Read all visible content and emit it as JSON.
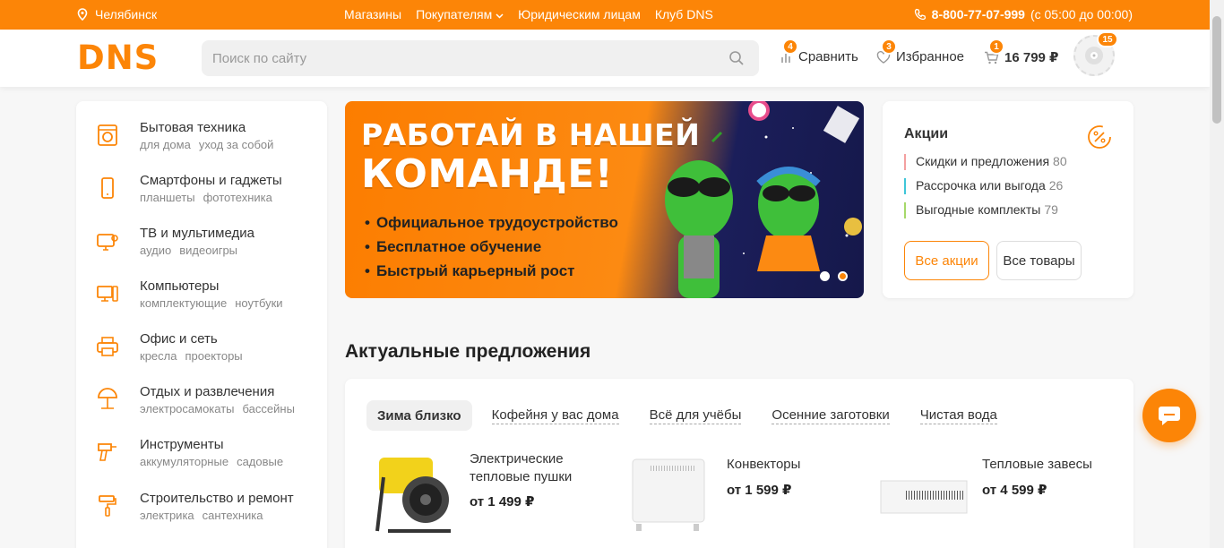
{
  "topbar": {
    "city": "Челябинск",
    "nav": [
      "Магазины",
      "Покупателям",
      "Юридическим лицам",
      "Клуб DNS"
    ],
    "phone": "8-800-77-07-999",
    "hours": "(с 05:00 до 00:00)"
  },
  "header": {
    "logo": "DNS",
    "search_placeholder": "Поиск по сайту",
    "compare_label": "Сравнить",
    "compare_count": "4",
    "favorites_label": "Избранное",
    "favorites_count": "3",
    "cart_count": "1",
    "cart_total": "16 799 ₽",
    "profile_count": "15"
  },
  "sidebar": {
    "items": [
      {
        "title": "Бытовая техника",
        "sub1": "для дома",
        "sub2": "уход за собой"
      },
      {
        "title": "Смартфоны и гаджеты",
        "sub1": "планшеты",
        "sub2": "фототехника"
      },
      {
        "title": "ТВ и мультимедиа",
        "sub1": "аудио",
        "sub2": "видеоигры"
      },
      {
        "title": "Компьютеры",
        "sub1": "комплектующие",
        "sub2": "ноутбуки"
      },
      {
        "title": "Офис и сеть",
        "sub1": "кресла",
        "sub2": "проекторы"
      },
      {
        "title": "Отдых и развлечения",
        "sub1": "электросамокаты",
        "sub2": "бассейны"
      },
      {
        "title": "Инструменты",
        "sub1": "аккумуляторные",
        "sub2": "садовые"
      },
      {
        "title": "Строительство и ремонт",
        "sub1": "электрика",
        "sub2": "сантехника"
      }
    ]
  },
  "banner": {
    "line1": "РАБОТАЙ В НАШЕЙ",
    "line2": "КОМАНДЕ!",
    "bullets": [
      "Официальное трудоустройство",
      "Бесплатное обучение",
      "Быстрый карьерный рост"
    ]
  },
  "promo": {
    "title": "Акции",
    "items": [
      {
        "label": "Скидки и предложения",
        "count": "80",
        "color": "#f4a0a0"
      },
      {
        "label": "Рассрочка или выгода",
        "count": "26",
        "color": "#3fc6d9"
      },
      {
        "label": "Выгодные комплекты",
        "count": "79",
        "color": "#a6d96a"
      }
    ],
    "all_promos": "Все акции",
    "all_goods": "Все товары"
  },
  "offers": {
    "title": "Актуальные предложения",
    "tabs": [
      "Зима близко",
      "Кофейня у вас дома",
      "Всё для учёбы",
      "Осенние заготовки",
      "Чистая вода"
    ],
    "products": [
      {
        "name1": "Электрические",
        "name2": "тепловые пушки",
        "price": "от 1 499 ₽"
      },
      {
        "name1": "Конвекторы",
        "name2": "",
        "price": "от 1 599 ₽"
      },
      {
        "name1": "Тепловые завесы",
        "name2": "",
        "price": "от 4 599 ₽"
      }
    ]
  },
  "colors": {
    "brand": "#fc8507",
    "bg": "#f7f7f7"
  }
}
